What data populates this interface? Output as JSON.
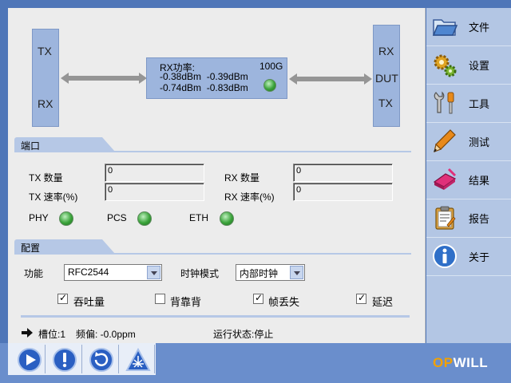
{
  "diagram": {
    "left_box": {
      "top": "TX",
      "bottom": "RX"
    },
    "right_box": {
      "top": "RX",
      "middle": "DUT",
      "bottom": "TX"
    },
    "rx_power": {
      "title": "RX功率:",
      "speed": "100G",
      "row1": "-0.38dBm  -0.39dBm",
      "row2": "-0.74dBm  -0.83dBm"
    }
  },
  "port": {
    "section_title": "端口",
    "tx_count_label": "TX 数量",
    "tx_count_value": "0",
    "tx_rate_label": "TX 速率(%)",
    "tx_rate_value": "0",
    "rx_count_label": "RX 数量",
    "rx_count_value": "0",
    "rx_rate_label": "RX 速率(%)",
    "rx_rate_value": "0",
    "leds": [
      {
        "label": "PHY"
      },
      {
        "label": "PCS"
      },
      {
        "label": "ETH"
      }
    ]
  },
  "config": {
    "section_title": "配置",
    "function_label": "功能",
    "function_value": "RFC2544",
    "clock_label": "时钟模式",
    "clock_value": "内部时钟",
    "checks": [
      {
        "label": "吞吐量",
        "checked": true
      },
      {
        "label": "背靠背",
        "checked": false
      },
      {
        "label": "帧丢失",
        "checked": true
      },
      {
        "label": "延迟",
        "checked": true
      }
    ]
  },
  "status": {
    "slot": "槽位:1",
    "freq": "频偏: -0.0ppm",
    "run": "运行状态:停止"
  },
  "sidebar": {
    "items": [
      {
        "label": "文件",
        "icon": "folder-icon"
      },
      {
        "label": "设置",
        "icon": "gears-icon"
      },
      {
        "label": "工具",
        "icon": "tools-icon"
      },
      {
        "label": "测试",
        "icon": "pencil-icon"
      },
      {
        "label": "结果",
        "icon": "eraser-icon"
      },
      {
        "label": "报告",
        "icon": "clipboard-icon"
      },
      {
        "label": "关于",
        "icon": "info-icon"
      }
    ]
  },
  "brand": {
    "logo_op": "OP",
    "logo_will": "WILL"
  },
  "toolbar": {
    "buttons": [
      {
        "icon": "play-icon"
      },
      {
        "icon": "alert-icon"
      },
      {
        "icon": "refresh-icon"
      },
      {
        "icon": "network-icon"
      }
    ]
  }
}
